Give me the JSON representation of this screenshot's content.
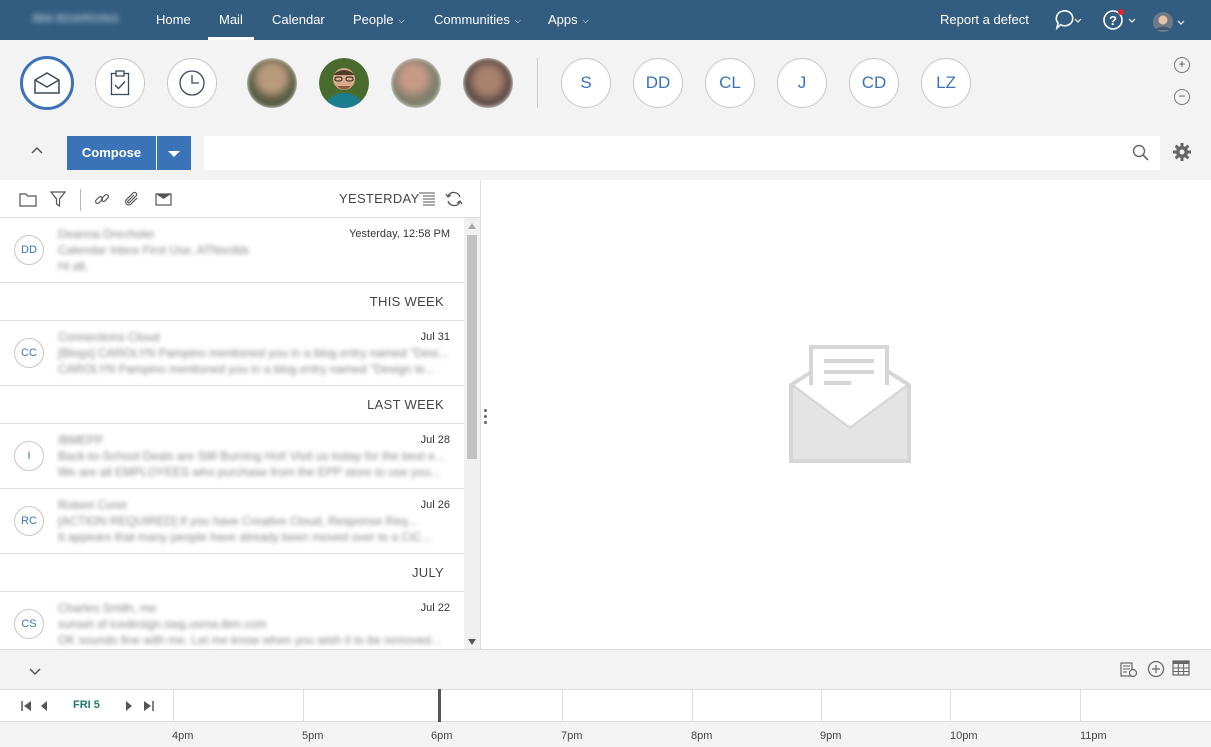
{
  "nav": {
    "brand": "IBM BOARDING",
    "items": [
      {
        "label": "Home"
      },
      {
        "label": "Mail"
      },
      {
        "label": "Calendar"
      },
      {
        "label": "People"
      },
      {
        "label": "Communities"
      },
      {
        "label": "Apps"
      }
    ],
    "report_defect": "Report a defect",
    "active": "Mail"
  },
  "shortcuts": {
    "app_icons": [
      "mail-icon",
      "tasks-icon",
      "clock-icon"
    ],
    "contacts": [
      {
        "initials": "S"
      },
      {
        "initials": "DD"
      },
      {
        "initials": "CL"
      },
      {
        "initials": "J"
      },
      {
        "initials": "CD"
      },
      {
        "initials": "LZ"
      }
    ]
  },
  "compose": {
    "label": "Compose",
    "search_value": ""
  },
  "list": {
    "filter_label": "YESTERDAY",
    "items": [
      {
        "initials": "DD",
        "date": "Yesterday, 12:58 PM",
        "from": "Deanna Drechsler",
        "subject": "Calendar Inbox First Use, ATNsrdds",
        "preview": "Hi all,"
      },
      {
        "section": "THIS WEEK"
      },
      {
        "initials": "CC",
        "date": "Jul 31",
        "from": "Connections Cloud",
        "subject": "[Blogs] CAROLYN Pampino mentioned you in a blog entry named \"Desi...",
        "preview": "CAROLYN Pampino mentioned you in a blog entry named \"Design te..."
      },
      {
        "section": "LAST WEEK"
      },
      {
        "initials": "I",
        "date": "Jul 28",
        "from": "IBMEPP",
        "subject": "Back-to-School Deals are Still Burning Hot! Visit us today for the best e...",
        "preview": "We are all EMPLOYEES who purchase from the EPP store to use you..."
      },
      {
        "initials": "RC",
        "date": "Jul 26",
        "from": "Robert Coret",
        "subject": "[ACTION REQUIRED] If you have Creative Cloud, Response Req...",
        "preview": "It appears that many people have already been moved over to a CiC..."
      },
      {
        "section": "JULY"
      },
      {
        "initials": "CS",
        "date": "Jul 22",
        "from": "Charles Smith, me",
        "subject": "sunset of icedesign.swg.usma.ibm.com",
        "preview": "OK sounds fine with me. Let me know when you wish it to be removed..."
      }
    ]
  },
  "calendar": {
    "day_label": "FRI 5",
    "hours": [
      "4pm",
      "5pm",
      "6pm",
      "7pm",
      "8pm",
      "9pm",
      "10pm",
      "11pm"
    ]
  },
  "colors": {
    "nav_bg": "#325c80",
    "accent": "#3b73b9",
    "strip_bg": "#f3f3f3",
    "calendar_day": "#1f7a6e"
  }
}
